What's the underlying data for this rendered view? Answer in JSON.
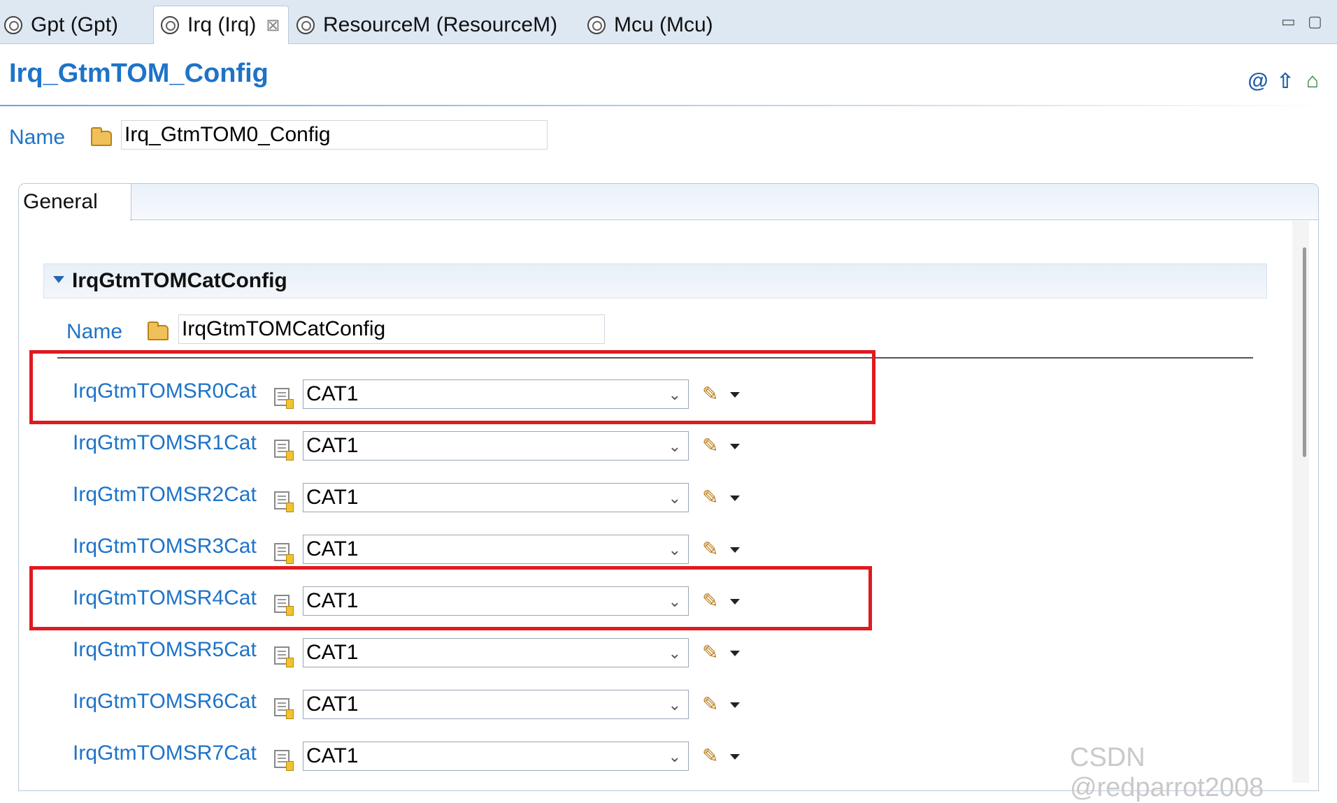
{
  "tabs": [
    {
      "label": "Gpt (Gpt)",
      "active": false
    },
    {
      "label": "Irq (Irq)",
      "active": true,
      "close": "⊠"
    },
    {
      "label": "ResourceM (ResourceM)",
      "active": false
    },
    {
      "label": "Mcu (Mcu)",
      "active": false
    }
  ],
  "window_controls": {
    "minimize": "▭",
    "maximize": "▢"
  },
  "header": {
    "title": "Irq_GtmTOM_Config",
    "icons": [
      "at-icon",
      "up-arrow-icon",
      "home-icon"
    ]
  },
  "name_field": {
    "label": "Name",
    "value": "Irq_GtmTOM0_Config"
  },
  "general_tab": {
    "label": "General"
  },
  "section": {
    "title": "IrqGtmTOMCatConfig",
    "name_label": "Name",
    "name_value": "IrqGtmTOMCatConfig",
    "rows": [
      {
        "label": "IrqGtmTOMSR0Cat",
        "value": "CAT1",
        "highlighted": true
      },
      {
        "label": "IrqGtmTOMSR1Cat",
        "value": "CAT1",
        "highlighted": false
      },
      {
        "label": "IrqGtmTOMSR2Cat",
        "value": "CAT1",
        "highlighted": false
      },
      {
        "label": "IrqGtmTOMSR3Cat",
        "value": "CAT1",
        "highlighted": false
      },
      {
        "label": "IrqGtmTOMSR4Cat",
        "value": "CAT1",
        "highlighted": true
      },
      {
        "label": "IrqGtmTOMSR5Cat",
        "value": "CAT1",
        "highlighted": false
      },
      {
        "label": "IrqGtmTOMSR6Cat",
        "value": "CAT1",
        "highlighted": false
      },
      {
        "label": "IrqGtmTOMSR7Cat",
        "value": "CAT1",
        "highlighted": false
      }
    ]
  },
  "colors": {
    "link_blue": "#1e73c8",
    "highlight_red": "#e01a1f"
  },
  "watermark": "CSDN @redparrot2008"
}
